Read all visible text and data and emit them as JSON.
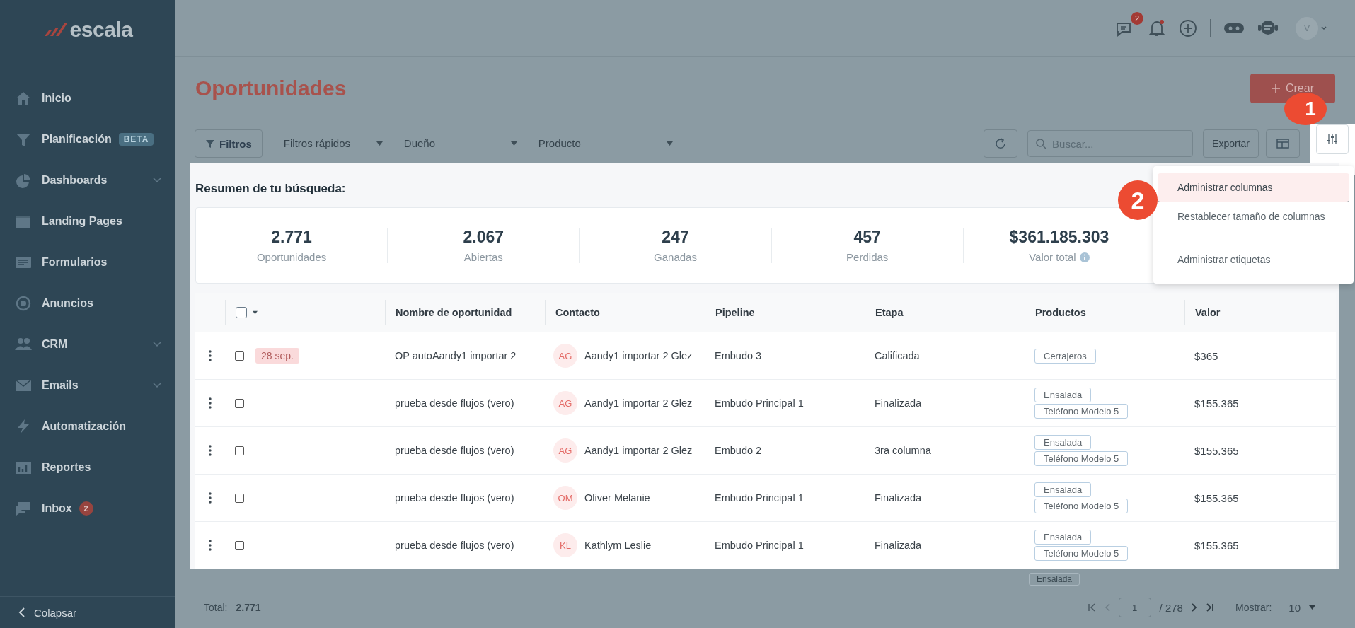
{
  "sidebar": {
    "logo": "escala",
    "items": [
      {
        "kind": "home",
        "label": "Inicio",
        "expandable": false
      },
      {
        "kind": "funnel",
        "label": "Planificación",
        "badge": "BETA",
        "expandable": false
      },
      {
        "kind": "pie",
        "label": "Dashboards",
        "expandable": true
      },
      {
        "kind": "page",
        "label": "Landing Pages",
        "expandable": false
      },
      {
        "kind": "form",
        "label": "Formularios",
        "expandable": false
      },
      {
        "kind": "target",
        "label": "Anuncios",
        "expandable": false
      },
      {
        "kind": "people",
        "label": "CRM",
        "expandable": true
      },
      {
        "kind": "mail",
        "label": "Emails",
        "expandable": true
      },
      {
        "kind": "bolt",
        "label": "Automatización",
        "expandable": false
      },
      {
        "kind": "bars",
        "label": "Reportes",
        "expandable": false
      },
      {
        "kind": "chat",
        "label": "Inbox",
        "count": "2",
        "expandable": false
      }
    ],
    "collapse": "Colapsar"
  },
  "topbar": {
    "chat_badge": "2",
    "avatar": "V"
  },
  "page_title": "Oportunidades",
  "create_button": "Crear",
  "filters": {
    "button": "Filtros",
    "selects": [
      "Filtros rápidos",
      "Dueño",
      "Producto"
    ],
    "search": {
      "placeholder": "Buscar..."
    },
    "export": "Exportar"
  },
  "callouts": [
    "1",
    "2"
  ],
  "summary": {
    "title": "Resumen de tu búsqueda:",
    "stats": [
      {
        "value": "2.771",
        "label": "Oportunidades",
        "info": false
      },
      {
        "value": "2.067",
        "label": "Abiertas",
        "info": false
      },
      {
        "value": "247",
        "label": "Ganadas",
        "info": false
      },
      {
        "value": "457",
        "label": "Perdidas",
        "info": false
      },
      {
        "value": "$361.185.303",
        "label": "Valor total",
        "info": true
      }
    ]
  },
  "table": {
    "select_all": {
      "checked": false
    },
    "columns": [
      "Nombre de oportunidad",
      "Contacto",
      "Pipeline",
      "Etapa",
      "Productos",
      "Valor"
    ],
    "rows": [
      {
        "checked": false,
        "task": true,
        "date_tag": "28 sep.",
        "name": "OP autoAandy1 importar 2",
        "initials": "AG",
        "contact": "Aandy1 importar 2 Glez",
        "pipeline": "Embudo 3",
        "stage": "Calificada",
        "products": [
          "Cerrajeros"
        ],
        "value": "$365"
      },
      {
        "checked": false,
        "task": false,
        "name": "prueba desde flujos (vero)",
        "initials": "AG",
        "contact": "Aandy1 importar 2 Glez",
        "pipeline": "Embudo Principal 1",
        "stage": "Finalizada",
        "products": [
          "Ensalada",
          "Teléfono Modelo 5"
        ],
        "value": "$155.365"
      },
      {
        "checked": false,
        "task": false,
        "name": "prueba desde flujos (vero)",
        "initials": "AG",
        "contact": "Aandy1 importar 2 Glez",
        "pipeline": "Embudo 2",
        "stage": "3ra columna",
        "products": [
          "Ensalada",
          "Teléfono Modelo 5"
        ],
        "value": "$155.365"
      },
      {
        "checked": false,
        "task": false,
        "name": "prueba desde flujos (vero)",
        "initials": "OM",
        "contact": "Oliver Melanie",
        "pipeline": "Embudo Principal 1",
        "stage": "Finalizada",
        "products": [
          "Ensalada",
          "Teléfono Modelo 5"
        ],
        "value": "$155.365"
      },
      {
        "checked": false,
        "task": false,
        "name": "prueba desde flujos (vero)",
        "initials": "KL",
        "contact": "Kathlym Leslie",
        "pipeline": "Embudo Principal 1",
        "stage": "Finalizada",
        "products": [
          "Ensalada",
          "Teléfono Modelo 5"
        ],
        "value": "$155.365"
      }
    ],
    "partial_row": {
      "products": [
        "Ensalada"
      ]
    }
  },
  "menu": [
    {
      "label": "Administrar columnas",
      "selected": true,
      "divider_before": false
    },
    {
      "label": "Restablecer tamaño de columnas",
      "selected": false,
      "divider_before": false
    },
    {
      "label": "Administrar etiquetas",
      "selected": false,
      "divider_before": true
    }
  ],
  "footer": {
    "total_label": "Total:",
    "total": "2.771",
    "page": "1",
    "pages": "/ 278",
    "show_label": "Mostrar:",
    "per_page": "10"
  }
}
